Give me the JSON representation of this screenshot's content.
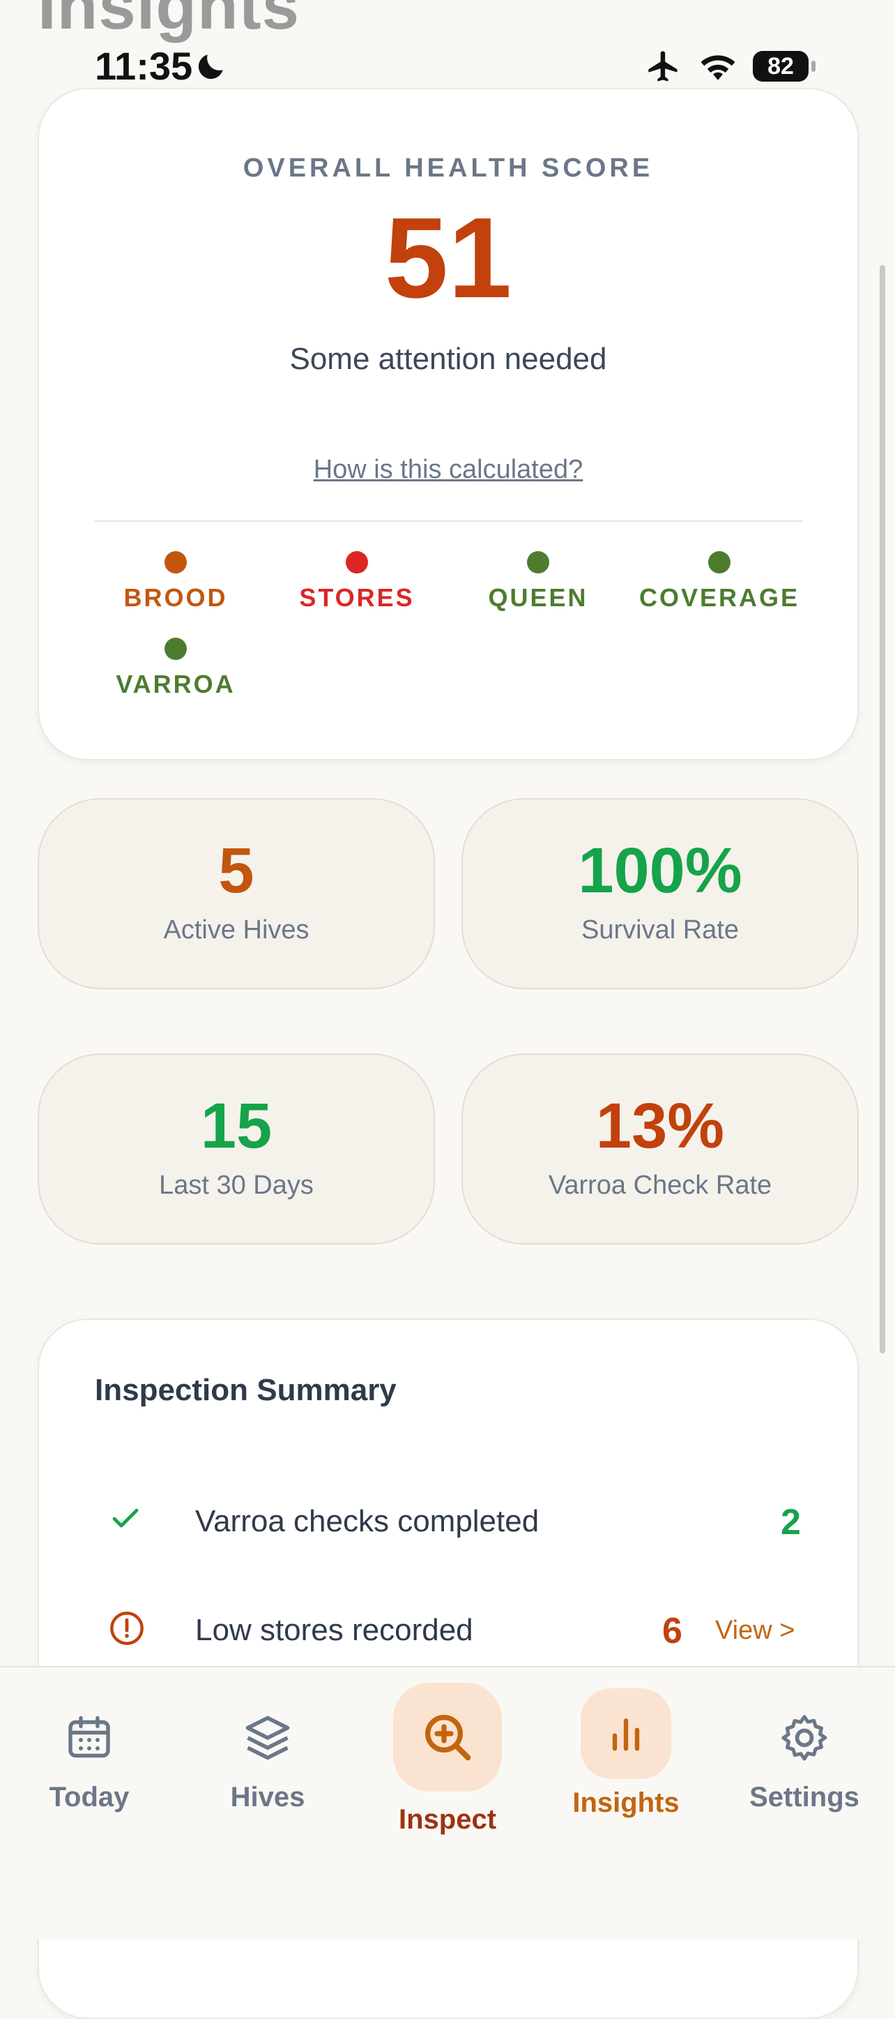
{
  "page": {
    "heading": "Insights"
  },
  "status_bar": {
    "time": "11:35",
    "battery": "82"
  },
  "health": {
    "eyebrow": "OVERALL HEALTH SCORE",
    "score": "51",
    "description": "Some attention needed",
    "link": "How is this calculated?",
    "factors": [
      {
        "label": "BROOD",
        "color": "#c2560f"
      },
      {
        "label": "STORES",
        "color": "#dc2626"
      },
      {
        "label": "QUEEN",
        "color": "#4d7c2f"
      },
      {
        "label": "COVERAGE",
        "color": "#4d7c2f"
      },
      {
        "label": "VARROA",
        "color": "#4d7c2f"
      }
    ]
  },
  "stats": [
    {
      "value": "5",
      "label": "Active Hives",
      "color": "#c2560f"
    },
    {
      "value": "100%",
      "label": "Survival Rate",
      "color": "#16a34a"
    },
    {
      "value": "15",
      "label": "Last 30 Days",
      "color": "#16a34a"
    },
    {
      "value": "13%",
      "label": "Varroa Check Rate",
      "color": "#c2410c"
    }
  ],
  "summary": {
    "title": "Inspection Summary",
    "rows": [
      {
        "text": "Varroa checks completed",
        "count": "2",
        "icon": "check-icon"
      },
      {
        "text": "Low stores recorded",
        "count": "6",
        "link": "View >",
        "icon": "alert-circle-icon"
      }
    ]
  },
  "tabs": [
    {
      "label": "Today",
      "icon": "calendar-icon"
    },
    {
      "label": "Hives",
      "icon": "layers-icon"
    },
    {
      "label": "Inspect",
      "icon": "search-plus-icon"
    },
    {
      "label": "Insights",
      "icon": "bar-chart-icon"
    },
    {
      "label": "Settings",
      "icon": "gear-icon"
    }
  ],
  "colors": {
    "accent": "#c2650f",
    "success": "#16a34a",
    "danger": "#c2410c"
  }
}
